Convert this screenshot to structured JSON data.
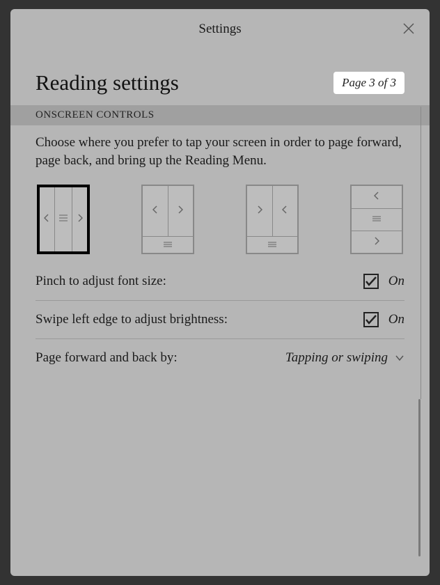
{
  "modal": {
    "title": "Settings"
  },
  "heading": "Reading settings",
  "page_indicator": "Page 3 of 3",
  "section_header": "ONSCREEN CONTROLS",
  "description": "Choose where you prefer to tap your screen in order to page forward, page back, and bring up the Reading Menu.",
  "settings": {
    "pinch_font": {
      "label": "Pinch to adjust font size:",
      "state": "On"
    },
    "swipe_brightness": {
      "label": "Swipe left edge to adjust brightness:",
      "state": "On"
    },
    "page_method": {
      "label": "Page forward and back by:",
      "value": "Tapping or swiping"
    }
  }
}
